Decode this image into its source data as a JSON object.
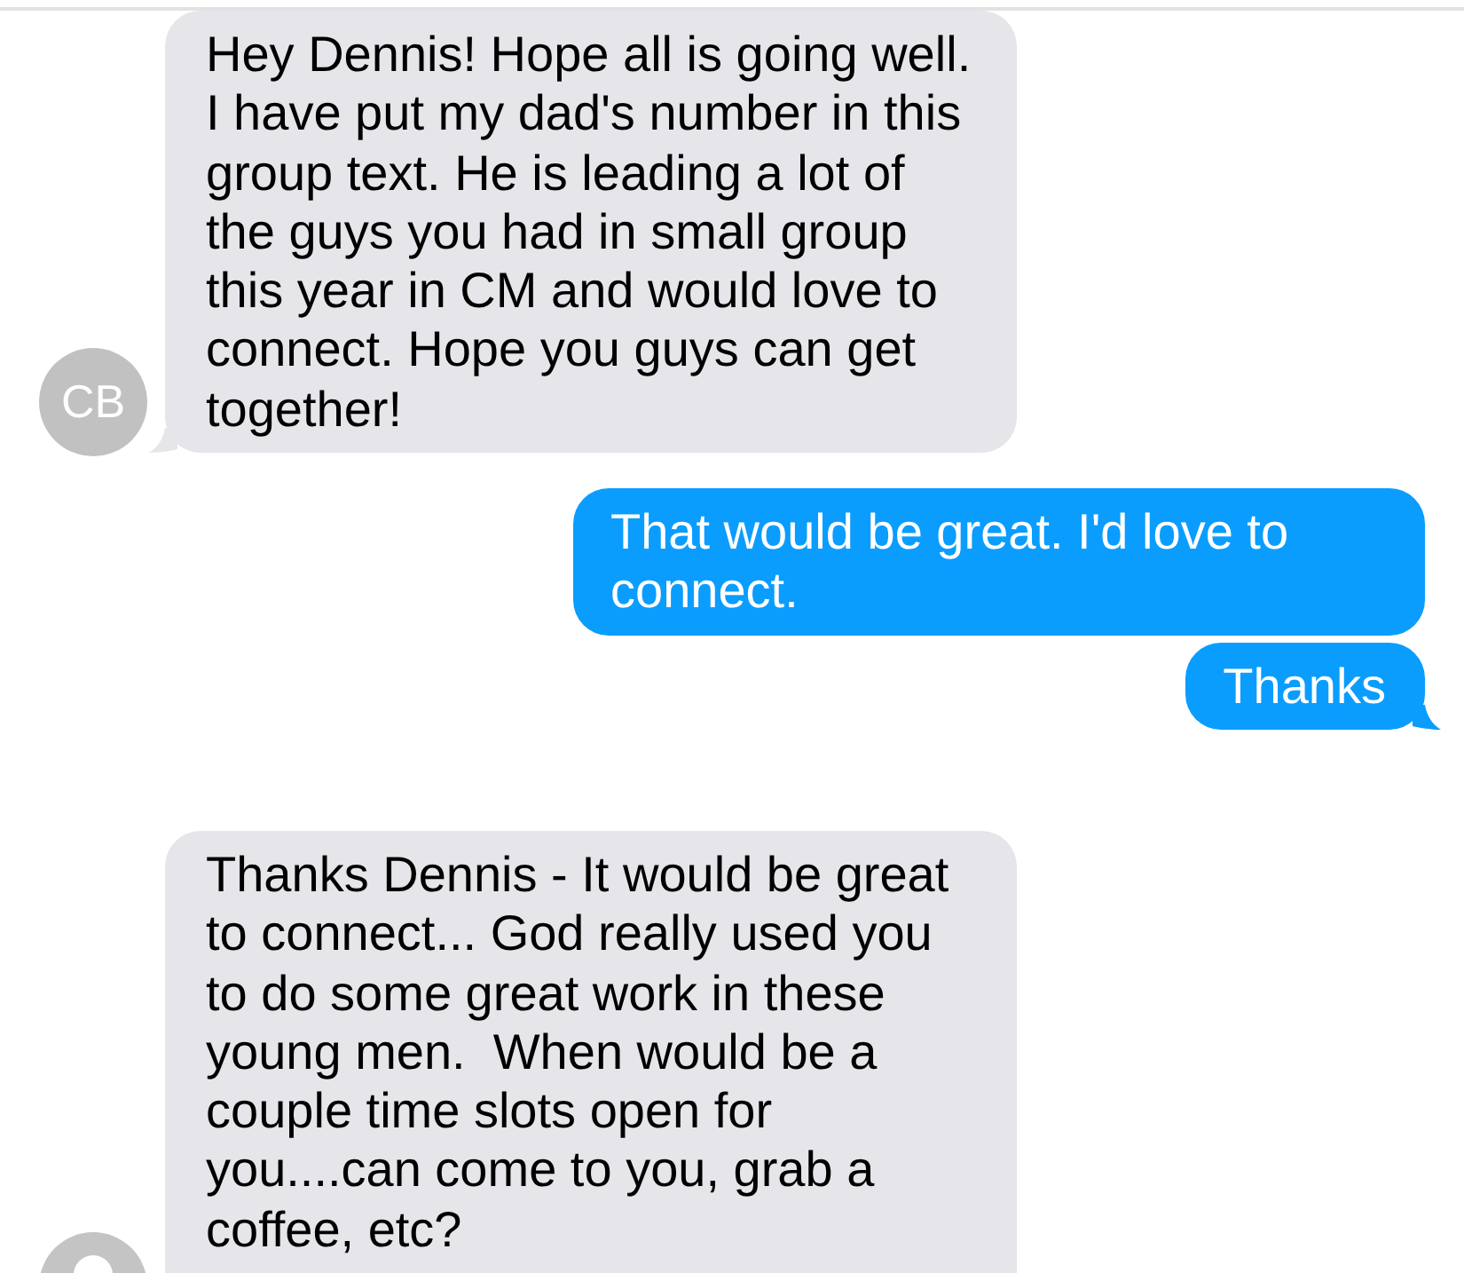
{
  "messages": [
    {
      "kind": "incoming",
      "text": "Hey Dennis! Hope all is going well. I have put my dad's number in this group text. He is leading a lot of the guys you had in small group this year in CM and would love to connect. Hope you guys can get together!",
      "tail": true,
      "avatar": {
        "kind": "initials",
        "text": "CB"
      }
    },
    {
      "kind": "outgoing",
      "text": "That would be great. I'd love to connect.",
      "tail": false
    },
    {
      "kind": "outgoing",
      "text": "Thanks",
      "tail": true
    },
    {
      "kind": "incoming",
      "text": "Thanks Dennis - It would be great to connect... God really used you to do some great work in these young men.  When would be a couple time slots open for you....can come to you, grab a coffee, etc?",
      "tail": false,
      "avatar": {
        "kind": "silhouette"
      }
    }
  ]
}
